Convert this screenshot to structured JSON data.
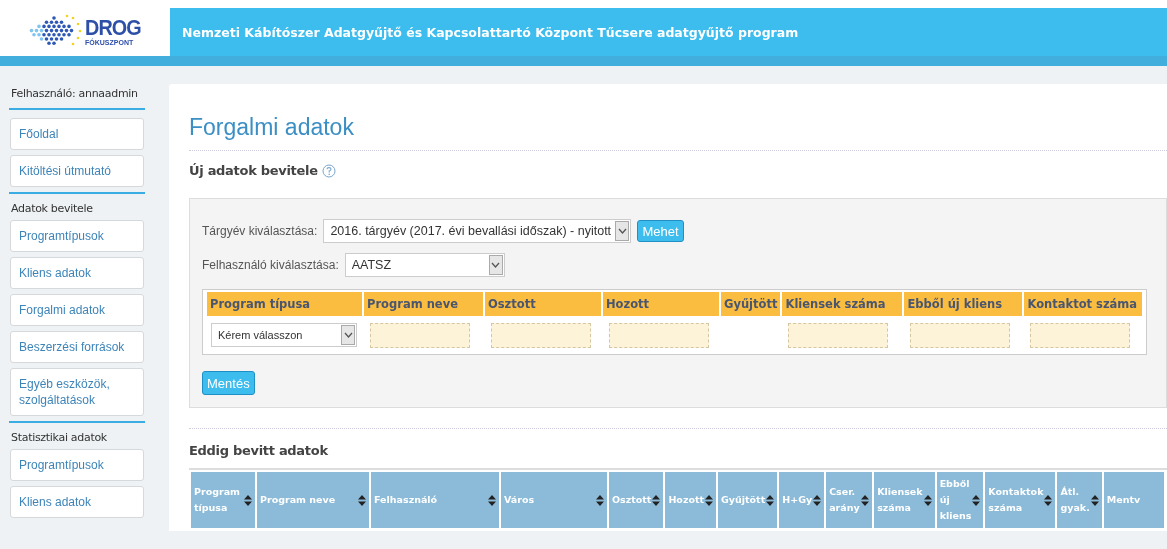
{
  "logo": {
    "title": "DROG",
    "subtitle": "FÓKUSZPONT"
  },
  "header": {
    "title": "Nemzeti Kábítószer Adatgyűjtő és Kapcsolattartó Központ Tűcsere adatgyűjtő program"
  },
  "sidebar": {
    "user_label": "Felhasználó: annaadmin",
    "groups": [
      {
        "items": [
          "Főoldal",
          "Kitöltési útmutató"
        ]
      },
      {
        "heading": "Adatok bevitele",
        "items": [
          "Programtípusok",
          "Kliens adatok",
          "Forgalmi adatok",
          "Beszerzési források",
          "Egyéb eszközök, szolgáltatások"
        ]
      },
      {
        "heading": "Statisztikai adatok",
        "items": [
          "Programtípusok",
          "Kliens adatok"
        ]
      }
    ]
  },
  "page": {
    "title": "Forgalmi adatok",
    "subtitle": "Új adatok bevitele",
    "form": {
      "year_label": "Tárgyév kiválasztása:",
      "year_value": "2016. tárgyév (2017. évi bevallási időszak) - nyitott",
      "go_button": "Mehet",
      "user_label": "Felhasználó kiválasztása:",
      "user_value": "AATSZ",
      "entry_table": {
        "columns": [
          "Program típusa",
          "Program neve",
          "Osztott",
          "Hozott",
          "Gyűjtött",
          "Kliensek száma",
          "Ebből új kliens",
          "Kontaktot száma"
        ],
        "row": [
          {
            "kind": "select",
            "value": "Kérem válasszon"
          },
          {
            "kind": "input"
          },
          {
            "kind": "input"
          },
          {
            "kind": "input"
          },
          {
            "kind": "empty"
          },
          {
            "kind": "input"
          },
          {
            "kind": "input"
          },
          {
            "kind": "input"
          }
        ]
      },
      "save_button": "Mentés"
    },
    "list_title": "Eddig bevitt adatok",
    "list_table": {
      "columns": [
        "Program típusa",
        "Program neve",
        "Felhasználó",
        "Város",
        "Osztott",
        "Hozott",
        "Gyűjtött",
        "H+Gy",
        "Cser. arány",
        "Kliensek száma",
        "Ebből új kliens",
        "Kontaktok száma",
        "Átl. gyak.",
        "Mentv"
      ]
    }
  }
}
